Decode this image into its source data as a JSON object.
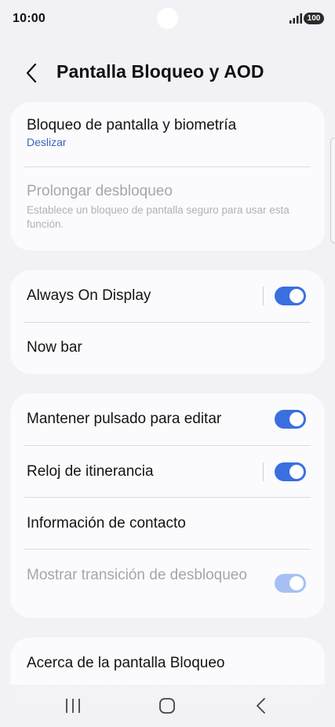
{
  "status_bar": {
    "time": "10:00",
    "battery": "100"
  },
  "header": {
    "title": "Pantalla Bloqueo y AOD"
  },
  "card1": {
    "lock_screen": {
      "label": "Bloqueo de pantalla y biometría",
      "value": "Deslizar"
    },
    "extend_unlock": {
      "label": "Prolongar desbloqueo",
      "description": "Establece un bloqueo de pantalla seguro para usar esta función."
    }
  },
  "card2": {
    "always_on": {
      "label": "Always On Display",
      "enabled": true
    },
    "now_bar": {
      "label": "Now bar"
    }
  },
  "card3": {
    "hold_to_edit": {
      "label": "Mantener pulsado para editar",
      "enabled": true
    },
    "roaming_clock": {
      "label": "Reloj de itinerancia",
      "enabled": true
    },
    "contact_info": {
      "label": "Información de contacto"
    },
    "unlock_transition": {
      "label": "Mostrar transición de desbloqueo",
      "enabled": true,
      "disabled": true
    }
  },
  "card4": {
    "about": {
      "label": "Acerca de la pantalla Bloqueo"
    }
  },
  "nav_bar": {
    "recents": "recents-icon",
    "home": "home-icon",
    "back": "back-icon"
  },
  "colors": {
    "accent": "#3a6fe0",
    "link": "#3a68b8",
    "background": "#f2f2f6",
    "card": "#fbfbfd"
  }
}
